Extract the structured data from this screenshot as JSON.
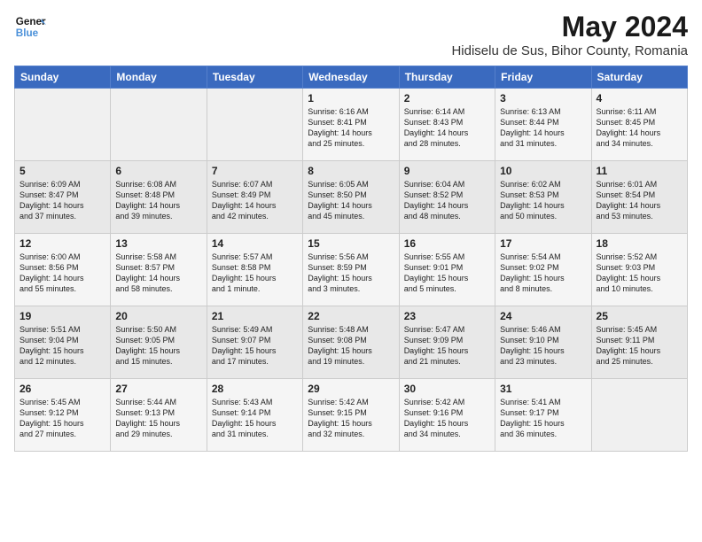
{
  "header": {
    "logo_line1": "General",
    "logo_line2": "Blue",
    "month": "May 2024",
    "location": "Hidiselu de Sus, Bihor County, Romania"
  },
  "weekdays": [
    "Sunday",
    "Monday",
    "Tuesday",
    "Wednesday",
    "Thursday",
    "Friday",
    "Saturday"
  ],
  "weeks": [
    [
      {
        "day": "",
        "info": ""
      },
      {
        "day": "",
        "info": ""
      },
      {
        "day": "",
        "info": ""
      },
      {
        "day": "1",
        "info": "Sunrise: 6:16 AM\nSunset: 8:41 PM\nDaylight: 14 hours\nand 25 minutes."
      },
      {
        "day": "2",
        "info": "Sunrise: 6:14 AM\nSunset: 8:43 PM\nDaylight: 14 hours\nand 28 minutes."
      },
      {
        "day": "3",
        "info": "Sunrise: 6:13 AM\nSunset: 8:44 PM\nDaylight: 14 hours\nand 31 minutes."
      },
      {
        "day": "4",
        "info": "Sunrise: 6:11 AM\nSunset: 8:45 PM\nDaylight: 14 hours\nand 34 minutes."
      }
    ],
    [
      {
        "day": "5",
        "info": "Sunrise: 6:09 AM\nSunset: 8:47 PM\nDaylight: 14 hours\nand 37 minutes."
      },
      {
        "day": "6",
        "info": "Sunrise: 6:08 AM\nSunset: 8:48 PM\nDaylight: 14 hours\nand 39 minutes."
      },
      {
        "day": "7",
        "info": "Sunrise: 6:07 AM\nSunset: 8:49 PM\nDaylight: 14 hours\nand 42 minutes."
      },
      {
        "day": "8",
        "info": "Sunrise: 6:05 AM\nSunset: 8:50 PM\nDaylight: 14 hours\nand 45 minutes."
      },
      {
        "day": "9",
        "info": "Sunrise: 6:04 AM\nSunset: 8:52 PM\nDaylight: 14 hours\nand 48 minutes."
      },
      {
        "day": "10",
        "info": "Sunrise: 6:02 AM\nSunset: 8:53 PM\nDaylight: 14 hours\nand 50 minutes."
      },
      {
        "day": "11",
        "info": "Sunrise: 6:01 AM\nSunset: 8:54 PM\nDaylight: 14 hours\nand 53 minutes."
      }
    ],
    [
      {
        "day": "12",
        "info": "Sunrise: 6:00 AM\nSunset: 8:56 PM\nDaylight: 14 hours\nand 55 minutes."
      },
      {
        "day": "13",
        "info": "Sunrise: 5:58 AM\nSunset: 8:57 PM\nDaylight: 14 hours\nand 58 minutes."
      },
      {
        "day": "14",
        "info": "Sunrise: 5:57 AM\nSunset: 8:58 PM\nDaylight: 15 hours\nand 1 minute."
      },
      {
        "day": "15",
        "info": "Sunrise: 5:56 AM\nSunset: 8:59 PM\nDaylight: 15 hours\nand 3 minutes."
      },
      {
        "day": "16",
        "info": "Sunrise: 5:55 AM\nSunset: 9:01 PM\nDaylight: 15 hours\nand 5 minutes."
      },
      {
        "day": "17",
        "info": "Sunrise: 5:54 AM\nSunset: 9:02 PM\nDaylight: 15 hours\nand 8 minutes."
      },
      {
        "day": "18",
        "info": "Sunrise: 5:52 AM\nSunset: 9:03 PM\nDaylight: 15 hours\nand 10 minutes."
      }
    ],
    [
      {
        "day": "19",
        "info": "Sunrise: 5:51 AM\nSunset: 9:04 PM\nDaylight: 15 hours\nand 12 minutes."
      },
      {
        "day": "20",
        "info": "Sunrise: 5:50 AM\nSunset: 9:05 PM\nDaylight: 15 hours\nand 15 minutes."
      },
      {
        "day": "21",
        "info": "Sunrise: 5:49 AM\nSunset: 9:07 PM\nDaylight: 15 hours\nand 17 minutes."
      },
      {
        "day": "22",
        "info": "Sunrise: 5:48 AM\nSunset: 9:08 PM\nDaylight: 15 hours\nand 19 minutes."
      },
      {
        "day": "23",
        "info": "Sunrise: 5:47 AM\nSunset: 9:09 PM\nDaylight: 15 hours\nand 21 minutes."
      },
      {
        "day": "24",
        "info": "Sunrise: 5:46 AM\nSunset: 9:10 PM\nDaylight: 15 hours\nand 23 minutes."
      },
      {
        "day": "25",
        "info": "Sunrise: 5:45 AM\nSunset: 9:11 PM\nDaylight: 15 hours\nand 25 minutes."
      }
    ],
    [
      {
        "day": "26",
        "info": "Sunrise: 5:45 AM\nSunset: 9:12 PM\nDaylight: 15 hours\nand 27 minutes."
      },
      {
        "day": "27",
        "info": "Sunrise: 5:44 AM\nSunset: 9:13 PM\nDaylight: 15 hours\nand 29 minutes."
      },
      {
        "day": "28",
        "info": "Sunrise: 5:43 AM\nSunset: 9:14 PM\nDaylight: 15 hours\nand 31 minutes."
      },
      {
        "day": "29",
        "info": "Sunrise: 5:42 AM\nSunset: 9:15 PM\nDaylight: 15 hours\nand 32 minutes."
      },
      {
        "day": "30",
        "info": "Sunrise: 5:42 AM\nSunset: 9:16 PM\nDaylight: 15 hours\nand 34 minutes."
      },
      {
        "day": "31",
        "info": "Sunrise: 5:41 AM\nSunset: 9:17 PM\nDaylight: 15 hours\nand 36 minutes."
      },
      {
        "day": "",
        "info": ""
      }
    ]
  ]
}
